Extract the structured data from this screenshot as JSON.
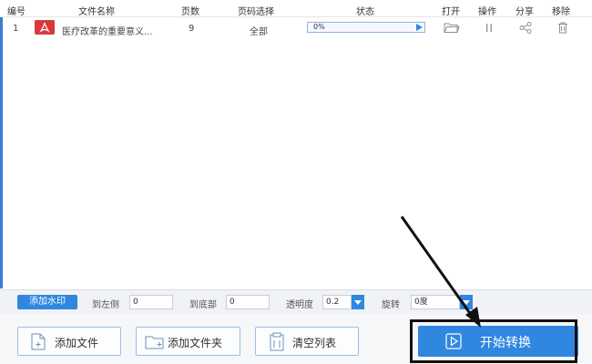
{
  "columns": {
    "num": "编号",
    "name": "文件名称",
    "pages": "页数",
    "page_select": "页码选择",
    "status": "状态",
    "open": "打开",
    "operate": "操作",
    "share": "分享",
    "remove": "移除"
  },
  "files": [
    {
      "index": "1",
      "name": "医疗改革的重要意义...",
      "pages": "9",
      "page_select": "全部",
      "progress_text": "0%",
      "progress": 0
    }
  ],
  "settings": {
    "watermark_btn": "添加水印",
    "left_label": "到左侧",
    "left_value": "0",
    "bottom_label": "到底部",
    "bottom_value": "0",
    "opacity_label": "透明度",
    "opacity_value": "0.2",
    "rotate_label": "旋转",
    "rotate_value": "0度"
  },
  "actions": {
    "add_file": "添加文件",
    "add_folder": "添加文件夹",
    "clear_list": "清空列表",
    "start": "开始转换"
  },
  "icons": [
    "pdf-file-icon",
    "folder-open-icon",
    "pause-icon",
    "share-icon",
    "trash-icon",
    "add-file-icon",
    "add-folder-icon",
    "clipboard-icon",
    "play-icon"
  ],
  "colors": {
    "accent": "#2f87e0",
    "pdf": "#d9393c"
  }
}
